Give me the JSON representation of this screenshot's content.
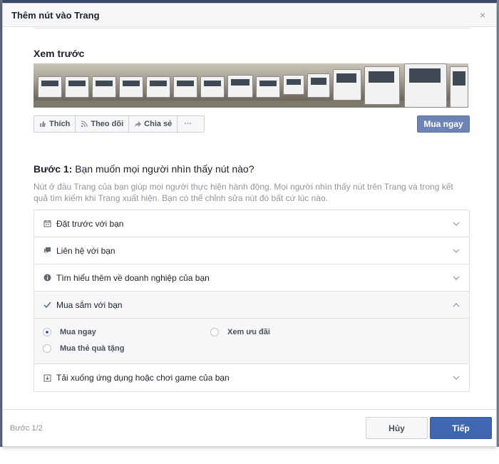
{
  "dialog": {
    "title": "Thêm nút vào Trang",
    "close_glyph": "×"
  },
  "preview": {
    "heading": "Xem trước",
    "actions": [
      {
        "icon": "thumbs-up-icon",
        "label": "Thích"
      },
      {
        "icon": "rss-icon",
        "label": "Theo dõi"
      },
      {
        "icon": "share-arrow-icon",
        "label": "Chia sẻ"
      },
      {
        "icon": "more-dots-icon",
        "label": "···"
      }
    ],
    "cta_label": "Mua ngay"
  },
  "step": {
    "prefix": "Bước 1:",
    "question": " Bạn muốn mọi người nhìn thấy nút nào?",
    "description": "Nút ở đầu Trang của bạn giúp mọi người thực hiện hành động. Mọi người nhìn thấy nút trên Trang và trong kết quả tìm kiếm khi Trang xuất hiện. Bạn có thể chỉnh sửa nút đó bất cứ lúc nào."
  },
  "options": [
    {
      "icon": "calendar-icon",
      "label": "Đặt trước với bạn",
      "expanded": false
    },
    {
      "icon": "chat-bubble-icon",
      "label": "Liên hệ với bạn",
      "expanded": false
    },
    {
      "icon": "info-icon",
      "label": "Tìm hiểu thêm về doanh nghiệp của bạn",
      "expanded": false
    },
    {
      "icon": "checkmark-icon",
      "label": "Mua sắm với bạn",
      "expanded": true
    },
    {
      "icon": "download-icon",
      "label": "Tải xuống ứng dụng hoặc chơi game của bạn",
      "expanded": false
    }
  ],
  "shop_choices": [
    {
      "label": "Mua ngay",
      "checked": true
    },
    {
      "label": "Xem ưu đãi",
      "checked": false
    },
    {
      "label": "Mua thẻ quà tặng",
      "checked": false
    }
  ],
  "footer": {
    "step_indicator": "Bước 1/2",
    "cancel_label": "Hủy",
    "next_label": "Tiếp"
  },
  "colors": {
    "primary": "#4267b2",
    "cta": "#6d84b4",
    "muted_text": "#90949c"
  }
}
